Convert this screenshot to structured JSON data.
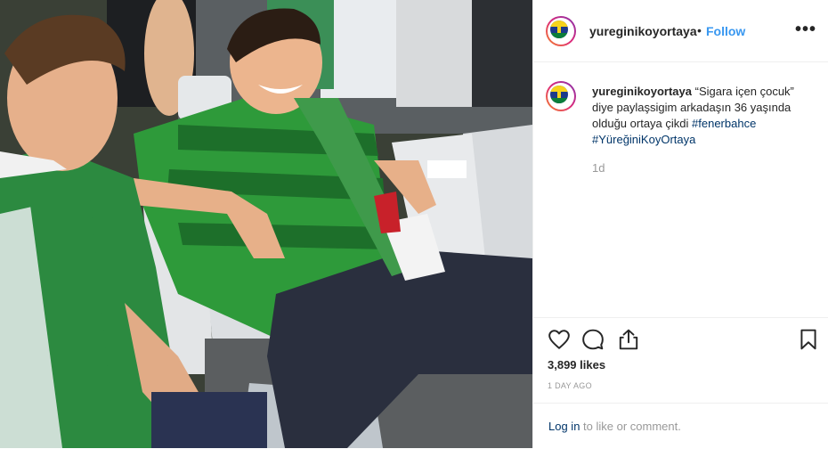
{
  "post": {
    "username": "yureginikoyortaya",
    "dot": "•",
    "follow_label": "Follow",
    "more_label": "•••",
    "caption_user": "yureginikoyortaya",
    "caption_text": " “Sigara içen çocuk” diye paylaşsigim arkadaşın 36 yaşında olduğu ortaya çikdi ",
    "hashtags": [
      "#fenerbahce",
      "#YüreğiniKoyOrtaya"
    ],
    "caption_time": "1d",
    "likes": "3,899 likes",
    "time_ago": "1 DAY AGO",
    "login_link": "Log in",
    "login_rest": " to like or comment.",
    "icons": [
      "heart-icon",
      "comment-icon",
      "share-icon",
      "bookmark-icon"
    ]
  },
  "colors": {
    "link": "#3897f0",
    "hashtag": "#003569",
    "muted": "#999999",
    "jersey_green": "#2f9b3c"
  }
}
